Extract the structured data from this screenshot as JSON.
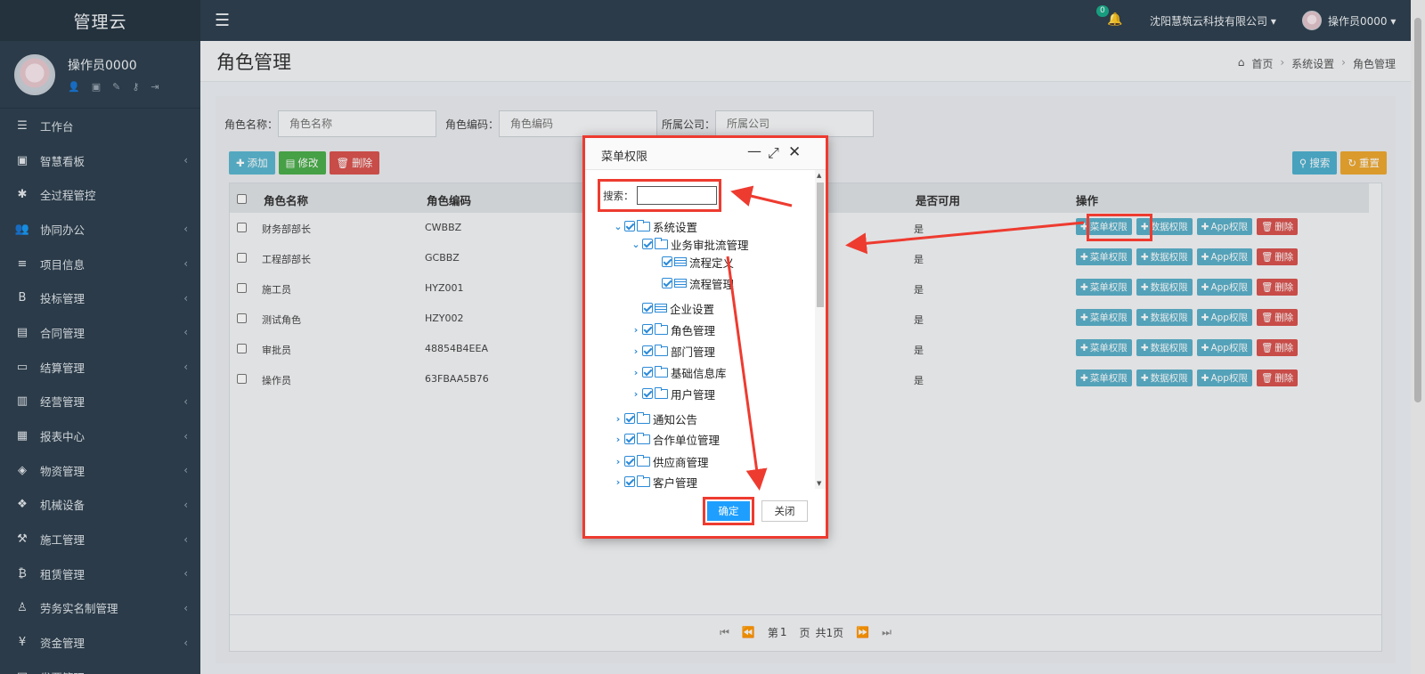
{
  "app": {
    "brand": "管理云",
    "sidebar_user": "操作员0000",
    "sidebar_user_icons": [
      "user-icon",
      "id-card-icon",
      "edit-icon",
      "key-icon",
      "sign-out-icon"
    ]
  },
  "sidebar": {
    "items": [
      {
        "label": "工作台",
        "icon": "list-icon",
        "glyph": "☰",
        "has_children": false
      },
      {
        "label": "智慧看板",
        "icon": "dashboard-icon",
        "glyph": "▣",
        "has_children": true
      },
      {
        "label": "全过程管控",
        "icon": "asterisk-icon",
        "glyph": "✱",
        "has_children": false
      },
      {
        "label": "协同办公",
        "icon": "users-icon",
        "glyph": "👥",
        "has_children": true
      },
      {
        "label": "项目信息",
        "icon": "bars-icon",
        "glyph": "≡",
        "has_children": true
      },
      {
        "label": "投标管理",
        "icon": "bold-icon",
        "glyph": "B",
        "has_children": true
      },
      {
        "label": "合同管理",
        "icon": "file-icon",
        "glyph": "▤",
        "has_children": true
      },
      {
        "label": "结算管理",
        "icon": "desktop-icon",
        "glyph": "▭",
        "has_children": true
      },
      {
        "label": "经营管理",
        "icon": "bar-chart-icon",
        "glyph": "▥",
        "has_children": true
      },
      {
        "label": "报表中心",
        "icon": "table-icon",
        "glyph": "▦",
        "has_children": true
      },
      {
        "label": "物资管理",
        "icon": "cube-icon",
        "glyph": "◈",
        "has_children": true
      },
      {
        "label": "机械设备",
        "icon": "cubes-icon",
        "glyph": "❖",
        "has_children": true
      },
      {
        "label": "施工管理",
        "icon": "gavel-icon",
        "glyph": "⚒",
        "has_children": true
      },
      {
        "label": "租赁管理",
        "icon": "bitcoin-icon",
        "glyph": "₿",
        "has_children": true
      },
      {
        "label": "劳务实名制管理",
        "icon": "user-badge-icon",
        "glyph": "♙",
        "has_children": true
      },
      {
        "label": "资金管理",
        "icon": "yen-icon",
        "glyph": "¥",
        "has_children": true
      },
      {
        "label": "发票管理",
        "icon": "invoice-icon",
        "glyph": "▤",
        "has_children": true
      }
    ]
  },
  "header": {
    "notification_count": "0",
    "company": "沈阳慧筑云科技有限公司",
    "user": "操作员0000"
  },
  "page": {
    "title": "角色管理",
    "breadcrumb": [
      "首页",
      "系统设置",
      "角色管理"
    ]
  },
  "filters": {
    "role_name_label": "角色名称：",
    "role_name_placeholder": "角色名称",
    "role_code_label": "角色编码：",
    "role_code_placeholder": "角色编码",
    "company_label": "所属公司：",
    "company_placeholder": "所属公司"
  },
  "toolbar": {
    "add": "添加",
    "edit": "修改",
    "delete": "删除",
    "search": "搜索",
    "reset": "重置"
  },
  "table": {
    "columns": [
      "角色名称",
      "角色编码",
      "",
      "是否可用",
      "操作"
    ],
    "rows": [
      {
        "name": "财务部部长",
        "code": "CWBBZ",
        "enabled": "是"
      },
      {
        "name": "工程部部长",
        "code": "GCBBZ",
        "enabled": "是"
      },
      {
        "name": "施工员",
        "code": "HYZ001",
        "enabled": "是"
      },
      {
        "name": "测试角色",
        "code": "HZY002",
        "enabled": "是"
      },
      {
        "name": "审批员",
        "code": "48854B4EEA",
        "enabled": "是"
      },
      {
        "name": "操作员",
        "code": "63FBAA5B76",
        "enabled": "是"
      }
    ],
    "row_actions": [
      "菜单权限",
      "数据权限",
      "App权限",
      "删除"
    ]
  },
  "pager": {
    "page_prefix": "第",
    "page_value": "1",
    "page_suffix": "页",
    "total": "共1页"
  },
  "modal": {
    "title": "菜单权限",
    "search_label": "搜索：",
    "search_value": "",
    "tree": [
      {
        "label": "系统设置",
        "level": 0,
        "expander": "open",
        "icon": "folder-open"
      },
      {
        "label": "业务审批流管理",
        "level": 1,
        "expander": "open",
        "icon": "folder-open"
      },
      {
        "label": "流程定义",
        "level": 2,
        "expander": "none",
        "icon": "page"
      },
      {
        "label": "流程管理",
        "level": 2,
        "expander": "none",
        "icon": "page"
      },
      {
        "label": "企业设置",
        "level": 1,
        "expander": "none",
        "icon": "page"
      },
      {
        "label": "角色管理",
        "level": 1,
        "expander": "closed",
        "icon": "folder"
      },
      {
        "label": "部门管理",
        "level": 1,
        "expander": "closed",
        "icon": "folder"
      },
      {
        "label": "基础信息库",
        "level": 1,
        "expander": "closed",
        "icon": "folder"
      },
      {
        "label": "用户管理",
        "level": 1,
        "expander": "closed",
        "icon": "folder"
      },
      {
        "label": "通知公告",
        "level": 0,
        "expander": "closed",
        "icon": "folder"
      },
      {
        "label": "合作单位管理",
        "level": 0,
        "expander": "closed",
        "icon": "folder"
      },
      {
        "label": "供应商管理",
        "level": 0,
        "expander": "closed",
        "icon": "folder"
      },
      {
        "label": "客户管理",
        "level": 0,
        "expander": "closed",
        "icon": "folder"
      }
    ],
    "ok": "确定",
    "close": "关闭"
  },
  "colors": {
    "sidebar_bg": "#2f4050",
    "highlight_red": "#ee3b30",
    "primary_blue": "#1e9fff",
    "info_btn": "#5bb0c9",
    "danger_btn": "#d9534f"
  }
}
